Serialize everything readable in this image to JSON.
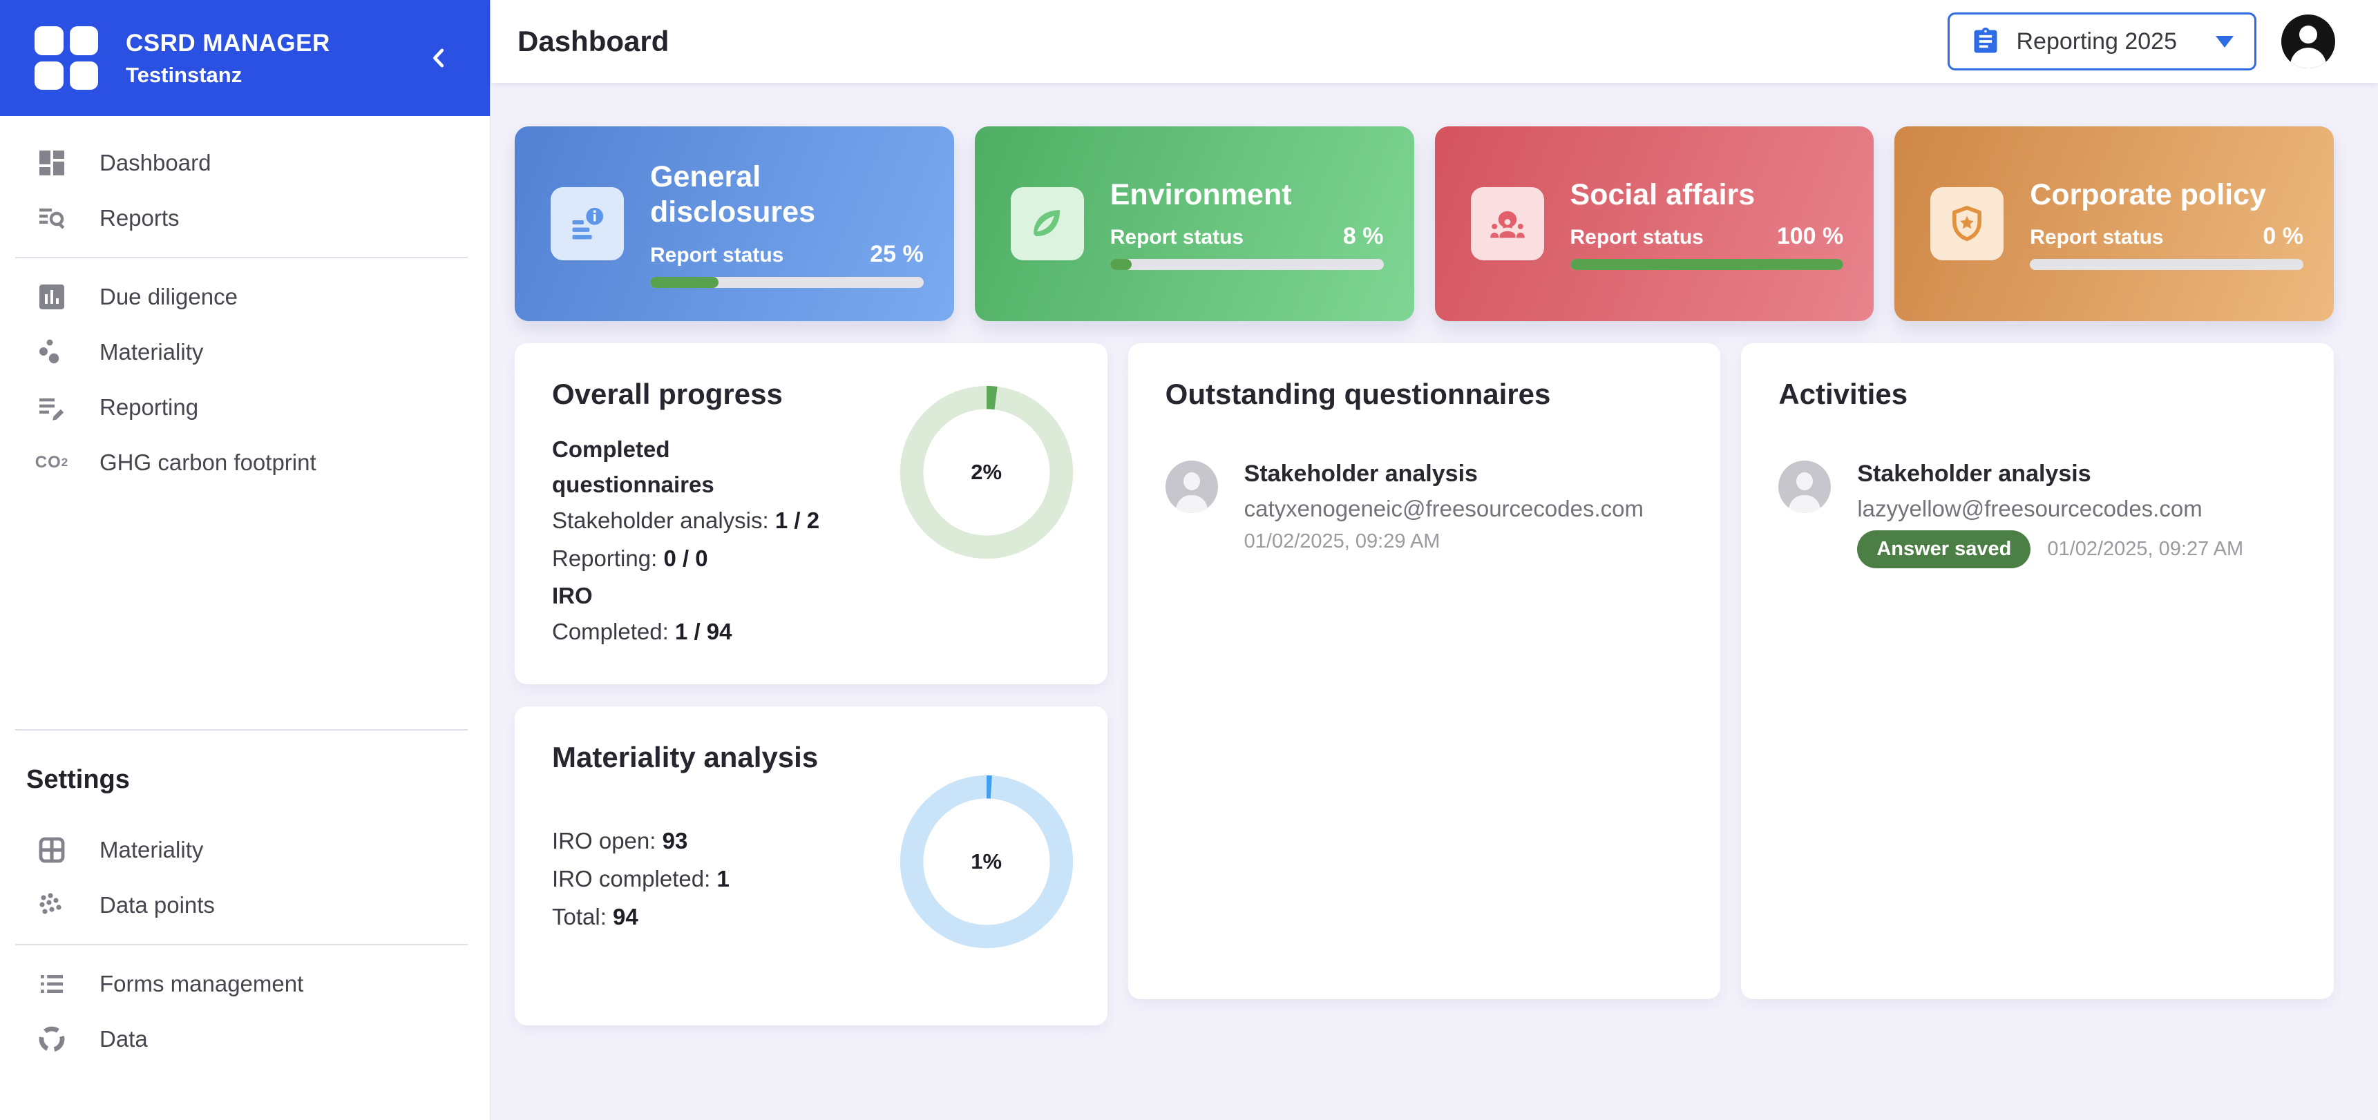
{
  "theme": {
    "sidebar_header_bg": "#2b51e3",
    "accent_blue": "#2e6be4",
    "page_bg": "#f3f2fb",
    "progress_fill_green": "#58a24d",
    "badge_green": "#4c7f45"
  },
  "sidebar": {
    "brand": {
      "line1": "CSRD MANAGER",
      "line2": "Testinstanz"
    },
    "collapse_icon": "chevron-left-icon",
    "nav_primary": [
      {
        "label": "Dashboard",
        "icon": "dashboard-icon"
      },
      {
        "label": "Reports",
        "icon": "reports-search-icon"
      }
    ],
    "nav_main": [
      {
        "label": "Due diligence",
        "icon": "bar-chart-icon"
      },
      {
        "label": "Materiality",
        "icon": "bubble-chart-icon"
      },
      {
        "label": "Reporting",
        "icon": "report-edit-icon"
      },
      {
        "label": "GHG carbon footprint",
        "icon": "co2-icon"
      }
    ],
    "settings_heading": "Settings",
    "nav_settings": [
      {
        "label": "Materiality",
        "icon": "grid-window-icon"
      },
      {
        "label": "Data points",
        "icon": "data-points-icon"
      }
    ],
    "nav_footer": [
      {
        "label": "Forms management",
        "icon": "list-icon"
      },
      {
        "label": "Data",
        "icon": "dashed-circle-icon"
      }
    ]
  },
  "topbar": {
    "title": "Dashboard",
    "period_selector": {
      "label": "Reporting 2025",
      "icon": "clipboard-icon",
      "caret": "caret-down-icon"
    },
    "avatar": "account-icon"
  },
  "status_cards": [
    {
      "title": "General disclosures",
      "status_label": "Report status",
      "percent": 25,
      "percent_label": "25 %",
      "icon": "document-info-icon",
      "colors": {
        "from": "#5381d3",
        "to": "#7aabf0",
        "tile": "#dce9fb",
        "glyph": "#5f97e8"
      }
    },
    {
      "title": "Environment",
      "status_label": "Report status",
      "percent": 8,
      "percent_label": "8 %",
      "icon": "leaf-icon",
      "colors": {
        "from": "#4fae63",
        "to": "#7fd694",
        "tile": "#dcf3e0",
        "glyph": "#6bc87d"
      }
    },
    {
      "title": "Social affairs",
      "status_label": "Report status",
      "percent": 100,
      "percent_label": "100 %",
      "icon": "people-icon",
      "colors": {
        "from": "#d4545e",
        "to": "#e8838c",
        "tile": "#f9dfe0",
        "glyph": "#e2606c"
      }
    },
    {
      "title": "Corporate policy",
      "status_label": "Report status",
      "percent": 0,
      "percent_label": "0 %",
      "icon": "shield-star-icon",
      "colors": {
        "from": "#cf8747",
        "to": "#edb97e",
        "tile": "#fbe8d3",
        "glyph": "#e0923f"
      }
    }
  ],
  "overall_progress": {
    "title": "Overall progress",
    "subheading1": "Completed questionnaires",
    "rows1": [
      {
        "label": "Stakeholder analysis:",
        "value": "1 / 2"
      },
      {
        "label": "Reporting:",
        "value": "0 / 0"
      }
    ],
    "subheading2": "IRO",
    "rows2": [
      {
        "label": "Completed:",
        "value": "1 / 94"
      }
    ],
    "chart": {
      "type": "donut",
      "percent": 2,
      "label": "2%",
      "ring_color": "#dcead8",
      "value_color": "#5ea757"
    }
  },
  "materiality_analysis": {
    "title": "Materiality analysis",
    "rows": [
      {
        "label": "IRO open:",
        "value": "93"
      },
      {
        "label": "IRO completed:",
        "value": "1"
      },
      {
        "label": "Total:",
        "value": "94"
      }
    ],
    "chart": {
      "type": "donut",
      "percent": 1,
      "label": "1%",
      "ring_color": "#c9e3f8",
      "value_color": "#3f9ef2"
    }
  },
  "outstanding": {
    "title": "Outstanding questionnaires",
    "items": [
      {
        "title": "Stakeholder analysis",
        "email": "catyxenogeneic@freesourcecodes.com",
        "date": "01/02/2025, 09:29 AM"
      }
    ]
  },
  "activities": {
    "title": "Activities",
    "items": [
      {
        "title": "Stakeholder analysis",
        "email": "lazyyellow@freesourcecodes.com",
        "badge": "Answer saved",
        "date": "01/02/2025, 09:27 AM"
      }
    ]
  }
}
